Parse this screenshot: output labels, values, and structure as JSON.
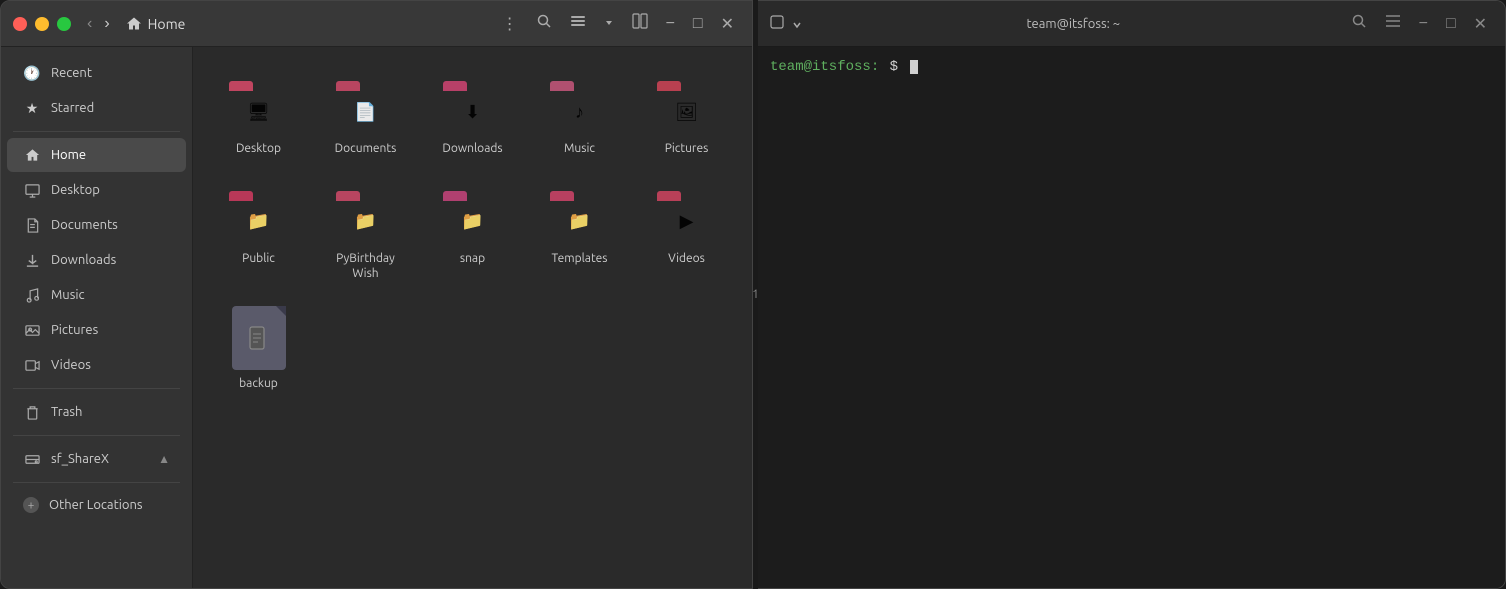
{
  "filemanager": {
    "title": "Home",
    "titlebar": {
      "back_label": "‹",
      "forward_label": "›",
      "home_label": "Home",
      "more_label": "⋮",
      "search_label": "🔍",
      "view_label": "☰",
      "split_label": "⊡",
      "close_label": "✕",
      "min_label": "−",
      "max_label": "□"
    },
    "sidebar": {
      "items": [
        {
          "id": "recent",
          "label": "Recent",
          "icon": "🕐"
        },
        {
          "id": "starred",
          "label": "Starred",
          "icon": "★"
        },
        {
          "id": "home",
          "label": "Home",
          "icon": "⌂",
          "active": true
        },
        {
          "id": "desktop",
          "label": "Desktop",
          "icon": "🖥"
        },
        {
          "id": "documents",
          "label": "Documents",
          "icon": "📄"
        },
        {
          "id": "downloads",
          "label": "Downloads",
          "icon": "⬇"
        },
        {
          "id": "music",
          "label": "Music",
          "icon": "♪"
        },
        {
          "id": "pictures",
          "label": "Pictures",
          "icon": "🖼"
        },
        {
          "id": "videos",
          "label": "Videos",
          "icon": "▶"
        },
        {
          "id": "trash",
          "label": "Trash",
          "icon": "🗑"
        },
        {
          "id": "sf_sharex",
          "label": "sf_ShareX",
          "icon": "💾",
          "eject": true
        },
        {
          "id": "other-locations",
          "label": "Other Locations",
          "icon": "+"
        }
      ]
    },
    "files": [
      {
        "id": "desktop",
        "name": "Desktop",
        "type": "folder",
        "icon": "🖥"
      },
      {
        "id": "documents",
        "name": "Documents",
        "type": "folder",
        "icon": "📄"
      },
      {
        "id": "downloads",
        "name": "Downloads",
        "type": "folder",
        "icon": "⬇"
      },
      {
        "id": "music",
        "name": "Music",
        "type": "folder",
        "icon": "♪"
      },
      {
        "id": "pictures",
        "name": "Pictures",
        "type": "folder",
        "icon": "🖼"
      },
      {
        "id": "public",
        "name": "Public",
        "type": "folder",
        "icon": "📁"
      },
      {
        "id": "pybirthday",
        "name": "PyBirthday\nWish",
        "type": "folder",
        "icon": "📁"
      },
      {
        "id": "snap",
        "name": "snap",
        "type": "folder",
        "icon": "📁"
      },
      {
        "id": "templates",
        "name": "Templates",
        "type": "folder",
        "icon": "📁"
      },
      {
        "id": "videos",
        "name": "Videos",
        "type": "folder",
        "icon": "▶"
      },
      {
        "id": "backup",
        "name": "backup",
        "type": "file",
        "icon": "📄"
      }
    ]
  },
  "terminal": {
    "title": "team@itsfoss: ~",
    "prompt_user": "team@itsfoss:",
    "prompt_symbol": "$",
    "tab_icon": "□",
    "close_label": "✕",
    "min_label": "−",
    "max_label": "□",
    "search_icon": "🔍",
    "menu_icon": "☰"
  },
  "divider": {
    "label": "1"
  }
}
